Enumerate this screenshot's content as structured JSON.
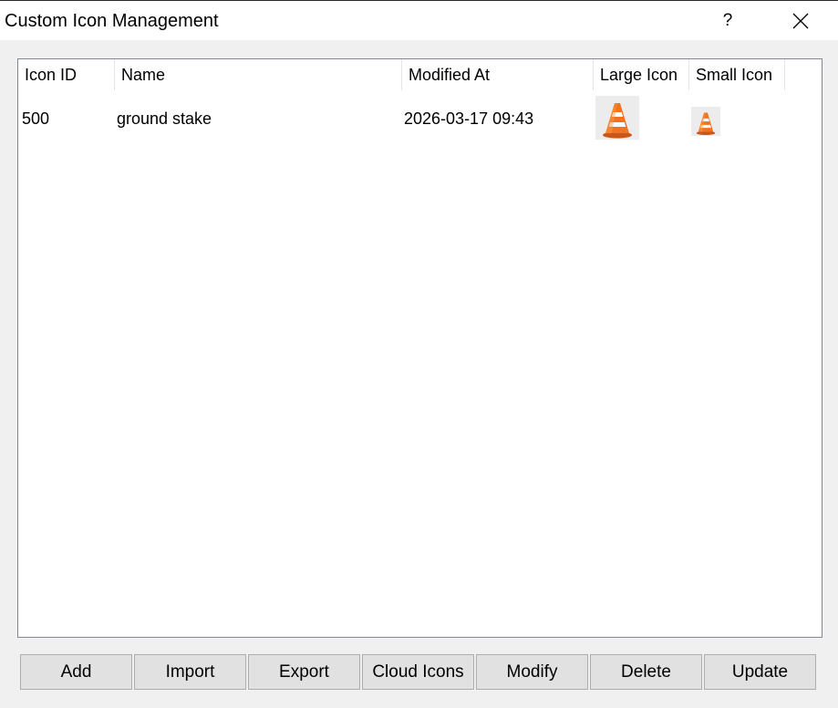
{
  "window": {
    "title": "Custom Icon Management",
    "help_label": "?"
  },
  "table": {
    "columns": [
      "Icon ID",
      "Name",
      "Modified At",
      "Large Icon",
      "Small Icon"
    ],
    "rows": [
      {
        "icon_id": "500",
        "name": "ground stake",
        "modified_at": "2026-03-17 09:43",
        "large_icon": "traffic-cone-icon",
        "small_icon": "traffic-cone-icon"
      }
    ]
  },
  "buttons": {
    "add": "Add",
    "import": "Import",
    "export": "Export",
    "cloud_icons": "Cloud Icons",
    "modify": "Modify",
    "delete": "Delete",
    "update": "Update"
  },
  "colors": {
    "cone_orange": "#f0731e",
    "cone_stripe": "#ffffff"
  }
}
